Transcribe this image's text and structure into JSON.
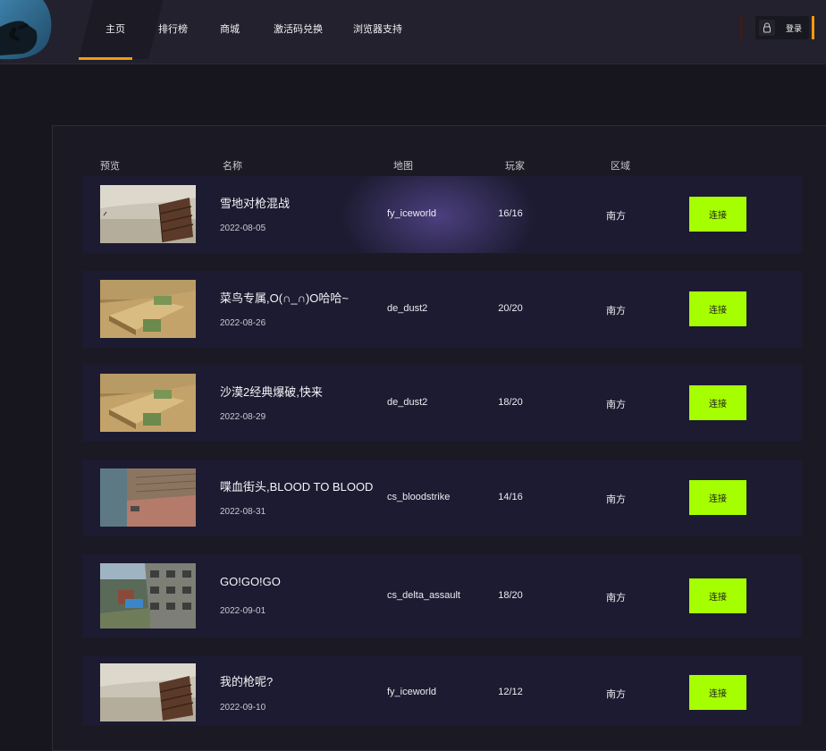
{
  "nav": {
    "items": [
      {
        "label": "主页",
        "active": true
      },
      {
        "label": "排行榜"
      },
      {
        "label": "商城"
      },
      {
        "label": "激活码兑换"
      },
      {
        "label": "浏览器支持"
      }
    ],
    "login_label": "登录",
    "login_icon": "lock-icon"
  },
  "colors": {
    "accent": "#f29a12",
    "connect": "#a6ff00",
    "row_bg": "#1c1b31",
    "page_bg": "#17161f"
  },
  "table": {
    "headers": {
      "preview": "预览",
      "name": "名称",
      "map": "地图",
      "players": "玩家",
      "region": "区域"
    },
    "rows": [
      {
        "name": "雪地对枪混战",
        "date": "2022-08-05",
        "map": "fy_iceworld",
        "players": "16/16",
        "region": "南方",
        "connect": "连接",
        "thumb": "iceworld"
      },
      {
        "name": "菜鸟专属,O(∩_∩)O哈哈~",
        "date": "2022-08-26",
        "map": "de_dust2",
        "players": "20/20",
        "region": "南方",
        "connect": "连接",
        "thumb": "dust2"
      },
      {
        "name": "沙漠2经典爆破,快来",
        "date": "2022-08-29",
        "map": "de_dust2",
        "players": "18/20",
        "region": "南方",
        "connect": "连接",
        "thumb": "dust2"
      },
      {
        "name": "喋血街头,BLOOD TO BLOOD",
        "date": "2022-08-31",
        "map": "cs_bloodstrike",
        "players": "14/16",
        "region": "南方",
        "connect": "连接",
        "thumb": "bloodstrike"
      },
      {
        "name": "GO!GO!GO",
        "date": "2022-09-01",
        "map": "cs_delta_assault",
        "players": "18/20",
        "region": "南方",
        "connect": "连接",
        "thumb": "delta"
      },
      {
        "name": "我的枪呢?",
        "date": "2022-09-10",
        "map": "fy_iceworld",
        "players": "12/12",
        "region": "南方",
        "connect": "连接",
        "thumb": "iceworld"
      }
    ]
  }
}
